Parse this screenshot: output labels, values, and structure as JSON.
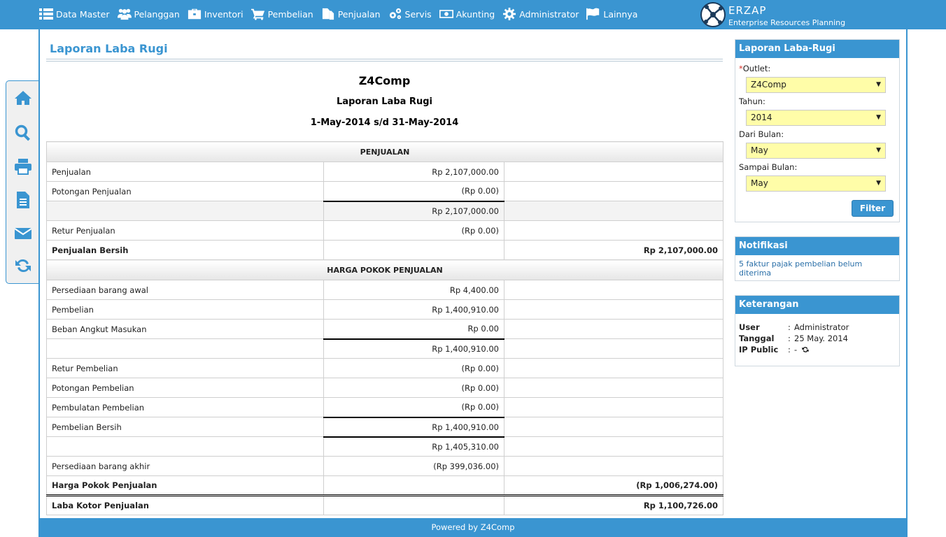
{
  "nav": [
    {
      "label": "Data Master",
      "icon": "list-icon"
    },
    {
      "label": "Pelanggan",
      "icon": "users-icon"
    },
    {
      "label": "Inventori",
      "icon": "briefcase-icon"
    },
    {
      "label": "Pembelian",
      "icon": "cart-icon"
    },
    {
      "label": "Penjualan",
      "icon": "documents-icon"
    },
    {
      "label": "Servis",
      "icon": "gears-icon"
    },
    {
      "label": "Akunting",
      "icon": "money-icon"
    },
    {
      "label": "Administrator",
      "icon": "gear-icon"
    },
    {
      "label": "Lainnya",
      "icon": "flag-icon"
    }
  ],
  "brand": {
    "name": "ERZAP",
    "tagline": "Enterprise Resources Planning"
  },
  "sidebar_icons": [
    "home-icon",
    "search-icon",
    "print-icon",
    "file-icon",
    "mail-icon",
    "refresh-icon"
  ],
  "page": {
    "title": "Laporan Laba Rugi"
  },
  "report": {
    "company": "Z4Comp",
    "name": "Laporan Laba Rugi",
    "period": "1-May-2014 s/d 31-May-2014",
    "rows": [
      {
        "type": "section",
        "label": "PENJUALAN"
      },
      {
        "label": "Penjualan",
        "mid": "Rp 2,107,000.00",
        "right": ""
      },
      {
        "label": "Potongan Penjualan",
        "mid": "(Rp 0.00)",
        "right": ""
      },
      {
        "label": "",
        "mid": "Rp 2,107,000.00",
        "right": "",
        "grey": true,
        "midTopLine": true
      },
      {
        "label": "Retur Penjualan",
        "mid": "(Rp 0.00)",
        "right": ""
      },
      {
        "label": "Penjualan Bersih",
        "mid": "",
        "right": "Rp 2,107,000.00",
        "bold": true
      },
      {
        "type": "section",
        "label": "HARGA POKOK PENJUALAN"
      },
      {
        "label": "Persediaan barang awal",
        "mid": "Rp 4,400.00",
        "right": ""
      },
      {
        "label": "Pembelian",
        "mid": "Rp 1,400,910.00",
        "right": ""
      },
      {
        "label": "Beban Angkut Masukan",
        "mid": "Rp 0.00",
        "right": ""
      },
      {
        "label": "",
        "mid": "Rp 1,400,910.00",
        "right": "",
        "midTopLine": true
      },
      {
        "label": "Retur Pembelian",
        "mid": "(Rp 0.00)",
        "right": ""
      },
      {
        "label": "Potongan Pembelian",
        "mid": "(Rp 0.00)",
        "right": ""
      },
      {
        "label": "Pembulatan Pembelian",
        "mid": "(Rp 0.00)",
        "right": ""
      },
      {
        "label": "Pembelian Bersih",
        "mid": "Rp 1,400,910.00",
        "right": "",
        "midTopLine": true
      },
      {
        "label": "",
        "mid": "Rp 1,405,310.00",
        "right": "",
        "midTopLine": true
      },
      {
        "label": "Persediaan barang akhir",
        "mid": "(Rp 399,036.00)",
        "right": ""
      },
      {
        "label": "Harga Pokok Penjualan",
        "mid": "",
        "right": "(Rp 1,006,274.00)",
        "bold": true
      },
      {
        "label": "Laba Kotor Penjualan",
        "mid": "",
        "right": "Rp 1,100,726.00",
        "bold": true,
        "double": true
      }
    ]
  },
  "filter_panel": {
    "title": "Laporan Laba-Rugi",
    "required_mark": "*",
    "outlet_label": "Outlet:",
    "outlet_value": "Z4Comp",
    "tahun_label": "Tahun:",
    "tahun_value": "2014",
    "dari_label": "Dari Bulan:",
    "dari_value": "May",
    "sampai_label": "Sampai Bulan:",
    "sampai_value": "May",
    "filter_button": "Filter",
    "dropdown_arrow": "▼"
  },
  "notif_panel": {
    "title": "Notifikasi",
    "message": "5 faktur pajak pembelian belum diterima"
  },
  "info_panel": {
    "title": "Keterangan",
    "user_label": "User",
    "user_value": "Administrator",
    "date_label": "Tanggal",
    "date_value": "25 May. 2014",
    "ip_label": "IP Public",
    "ip_value": "-",
    "colon": ":"
  },
  "footer": {
    "text": "Powered by Z4Comp"
  },
  "colors": {
    "accent": "#3a95d1",
    "select_bg": "#fffda8",
    "required": "#d9362c"
  }
}
